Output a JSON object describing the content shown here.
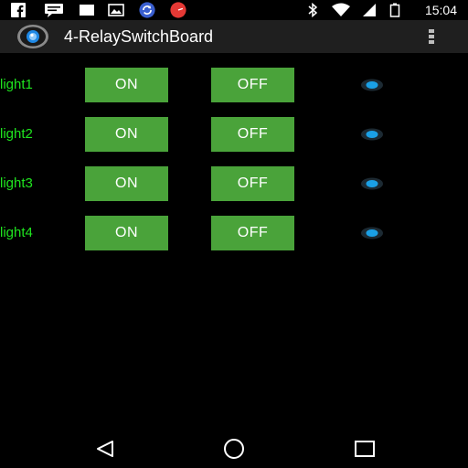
{
  "status_bar": {
    "time": "15:04",
    "icons": [
      "facebook-icon",
      "messenger-icon",
      "notification-box-icon",
      "image-icon",
      "sync-icon",
      "clock-app-icon",
      "bluetooth-icon",
      "wifi-icon",
      "battery-icon"
    ]
  },
  "app": {
    "title": "4-RelaySwitchBoard",
    "logo": "app-logo-icon",
    "menu": "overflow-menu-icon"
  },
  "colors": {
    "label_green": "#1fe51f",
    "button_green": "#4aa33a",
    "indicator_blue": "#1aa0e6"
  },
  "relays": [
    {
      "label": "light1",
      "on_label": "ON",
      "off_label": "OFF"
    },
    {
      "label": "light2",
      "on_label": "ON",
      "off_label": "OFF"
    },
    {
      "label": "light3",
      "on_label": "ON",
      "off_label": "OFF"
    },
    {
      "label": "light4",
      "on_label": "ON",
      "off_label": "OFF"
    }
  ],
  "nav_bar": {
    "icons": [
      "back-icon",
      "home-icon",
      "recents-icon"
    ]
  }
}
